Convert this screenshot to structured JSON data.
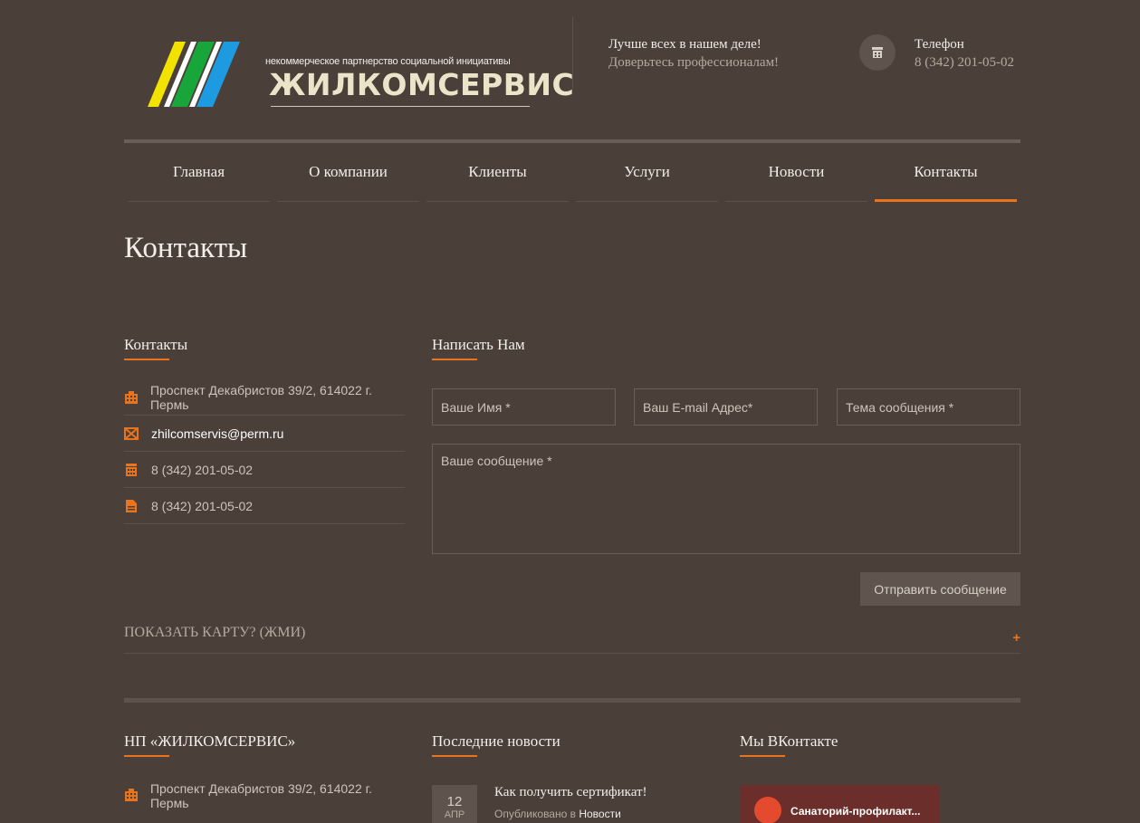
{
  "header": {
    "logo_small": "некоммерческое партнерство социальной инициативы",
    "logo_big": "ЖИЛКОМСЕРВИС",
    "tagline_1": "Лучше всех в нашем деле!",
    "tagline_2": "Доверьтесь профессионалам!",
    "phone_label": "Телефон",
    "phone_number": "8 (342) 201-05-02"
  },
  "nav": {
    "items": [
      "Главная",
      "О компании",
      "Клиенты",
      "Услуги",
      "Новости",
      "Контакты"
    ],
    "active": "Контакты"
  },
  "page_title": "Контакты",
  "contacts": {
    "title": "Контакты",
    "address": "Проспект Декабристов 39/2, 614022 г. Пермь",
    "email": "zhilcomservis@perm.ru",
    "phone": "8 (342) 201-05-02",
    "fax": "8 (342) 201-05-02"
  },
  "form": {
    "title": "Написать Нам",
    "name_placeholder": "Ваше Имя *",
    "email_placeholder": "Ваш E-mail Адрес*",
    "subject_placeholder": "Тема сообщения *",
    "message_placeholder": "Ваше сообщение *",
    "send_label": "Отправить сообщение"
  },
  "map_toggle": {
    "label": "ПОКАЗАТЬ КАРТУ? (ЖМИ)",
    "plus": "+"
  },
  "footer": {
    "org_title": "НП «ЖИЛКОМСЕРВИС»",
    "org_address": "Проспект Декабристов 39/2, 614022 г. Пермь",
    "news_title": "Последние новости",
    "news": {
      "day": "12",
      "month": "АПР",
      "headline": "Как получить сертификат!",
      "meta_prefix": "Опубликовано в",
      "category": "Новости"
    },
    "vk_title": "Мы ВКонтакте",
    "vk_group": "Санаторий-профилакт..."
  },
  "colors": {
    "background": "#4a3f39",
    "accent": "#e8741d",
    "stripe_yellow": "#f2e200",
    "stripe_green": "#18a63a",
    "stripe_blue": "#1e9be0"
  }
}
